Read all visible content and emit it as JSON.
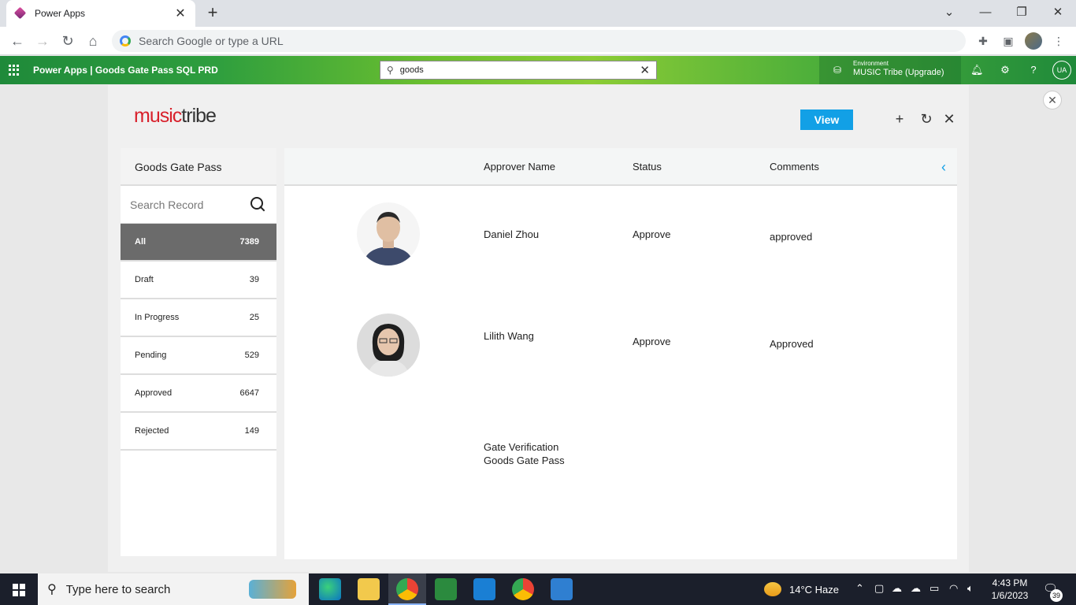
{
  "browser": {
    "tab_title": "Power Apps",
    "address_placeholder": "Search Google or type a URL"
  },
  "powerapps": {
    "title": "Power Apps  |  Goods Gate Pass SQL PRD",
    "search_value": "goods",
    "environment_label": "Environment",
    "environment_name": "MUSIC Tribe (Upgrade)",
    "user_initials": "UA"
  },
  "app": {
    "logo_part1": "music",
    "logo_part2": "tribe",
    "view_label": "View",
    "left_title": "Goods Gate Pass",
    "search_placeholder": "Search Record",
    "filters": [
      {
        "label": "All",
        "count": "7389"
      },
      {
        "label": "Draft",
        "count": "39"
      },
      {
        "label": "In Progress",
        "count": "25"
      },
      {
        "label": "Pending",
        "count": "529"
      },
      {
        "label": "Approved",
        "count": "6647"
      },
      {
        "label": "Rejected",
        "count": "149"
      }
    ],
    "columns": {
      "approver": "Approver Name",
      "status": "Status",
      "comments": "Comments"
    },
    "rows": [
      {
        "name": "Daniel Zhou",
        "status": "Approve",
        "comment": "approved"
      },
      {
        "name": "Lilith Wang",
        "status": "Approve",
        "comment": "Approved"
      },
      {
        "name": "Gate Verification\nGoods Gate Pass",
        "status": "",
        "comment": ""
      }
    ]
  },
  "taskbar": {
    "search_placeholder": "Type here to search",
    "weather": "14°C  Haze",
    "time": "4:43 PM",
    "date": "1/6/2023",
    "notification_count": "39"
  },
  "colors": {
    "accent": "#12a0e6",
    "brand_red": "#d8202b",
    "header_green": "#2e9e3e",
    "active_filter": "#6b6b6b"
  }
}
